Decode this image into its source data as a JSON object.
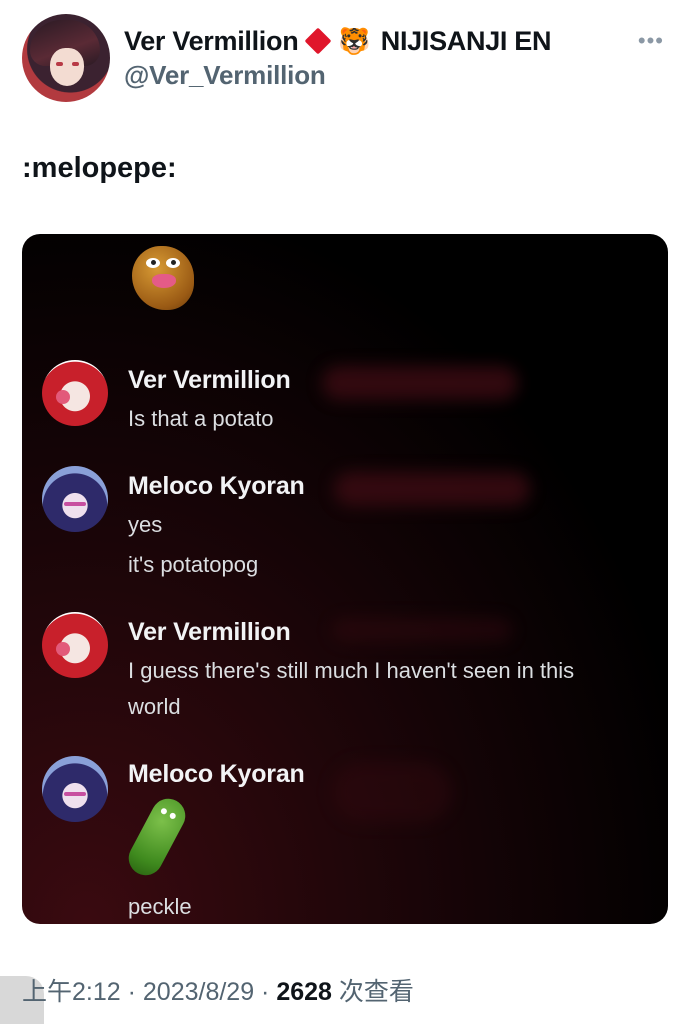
{
  "author": {
    "display_name": "Ver Vermillion",
    "org": "NIJISANJI EN",
    "handle": "@Ver_Vermillion",
    "badge_icon": "red-diamond-icon",
    "emoji_icon": "tiger-face-icon",
    "more_icon": "more-options-icon"
  },
  "tweet": {
    "text": ":melopepe:"
  },
  "chat": {
    "messages": [
      {
        "author": "Ver Vermillion",
        "lines": [
          "Is that a potato"
        ]
      },
      {
        "author": "Meloco Kyoran",
        "lines": [
          "yes",
          "it's potatopog"
        ]
      },
      {
        "author": "Ver Vermillion",
        "lines": [
          "I guess there's still much I haven't seen in this",
          "world"
        ]
      },
      {
        "author": "Meloco Kyoran",
        "lines": [
          "peckle"
        ]
      }
    ],
    "colors": {
      "background": "#000000",
      "accent": "#3a0a10"
    }
  },
  "footer": {
    "time": "上午2:12",
    "sep1": " · ",
    "date": "2023/8/29",
    "sep2": " · ",
    "views": "2628",
    "views_label": " 次查看"
  }
}
